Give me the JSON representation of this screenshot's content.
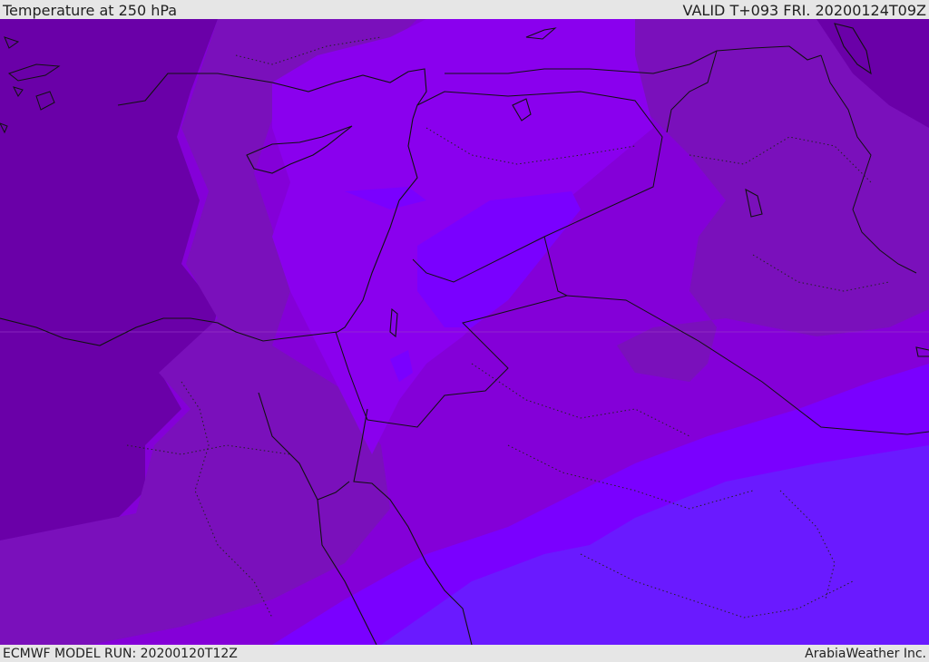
{
  "header": {
    "title": "Temperature at 250 hPa",
    "valid_time": "VALID T+093 FRI. 20200124T09Z"
  },
  "footer": {
    "model_run": "ECMWF MODEL RUN: 20200120T12Z",
    "credit": "ArabiaWeather Inc."
  },
  "map": {
    "field": "temperature-250hPa",
    "palette": {
      "coldest": "#5c0099",
      "cold": "#6a00a8",
      "mid_cold": "#7a10bb",
      "mid": "#8400d8",
      "mid_warm": "#8a00ee",
      "warm": "#7a00ff",
      "warmest": "#6a1aff",
      "border": "#111111"
    }
  }
}
